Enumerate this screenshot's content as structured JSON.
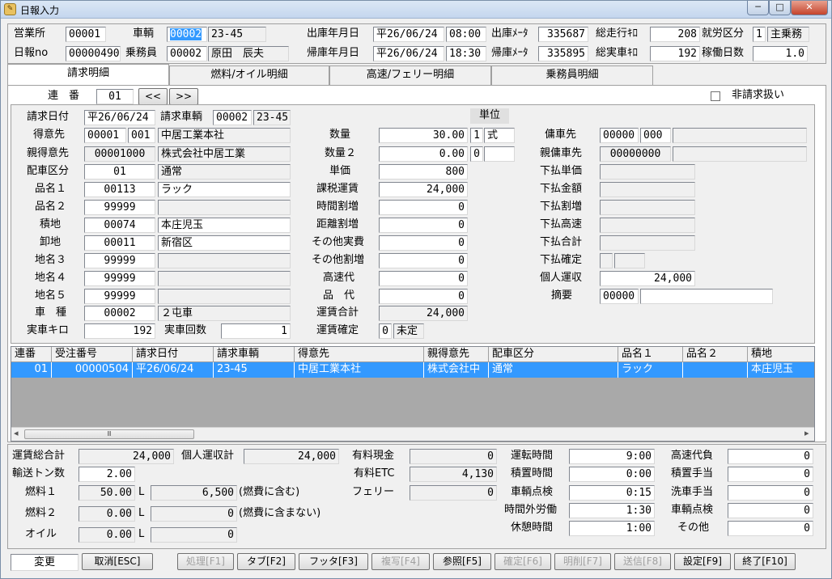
{
  "window": {
    "title": "日報入力",
    "minimize": "─",
    "maximize": "□",
    "close": "✕"
  },
  "header": {
    "office_label": "営業所",
    "office_value": "00001",
    "vehicle_label": "車輌",
    "vehicle_code": "00002",
    "vehicle_no": "23-45",
    "out_date_label": "出庫年月日",
    "out_date": "平26/06/24",
    "out_time": "08:00",
    "out_meter_label": "出庫ﾒｰﾀ",
    "out_meter": "335687",
    "total_km_label": "総走行ｷﾛ",
    "total_km": "208",
    "work_type_label": "就労区分",
    "work_type_code": "1",
    "work_type_name": "主乗務",
    "report_no_label": "日報no",
    "report_no": "00000490",
    "crew_label": "乗務員",
    "crew_code": "00002",
    "crew_name": "原田　辰夫",
    "in_date_label": "帰庫年月日",
    "in_date": "平26/06/24",
    "in_time": "18:30",
    "in_meter_label": "帰庫ﾒｰﾀ",
    "in_meter": "335895",
    "actual_km_label": "総実車ｷﾛ",
    "actual_km": "192",
    "work_days_label": "稼働日数",
    "work_days": "1.0"
  },
  "tabs": [
    "請求明細",
    "燃料/オイル明細",
    "高速/フェリー明細",
    "乗務員明細"
  ],
  "detail": {
    "seq_label": "連　番",
    "seq": "01",
    "prev": "<<",
    "next": ">>",
    "nonbill_label": "非請求扱い",
    "bill_date_label": "請求日付",
    "bill_date": "平26/06/24",
    "bill_vehicle_label": "請求車輌",
    "bill_vehicle_code": "00002",
    "bill_vehicle_no": "23-45",
    "customer_label": "得意先",
    "customer_code": "00001",
    "customer_sub": "001",
    "customer_name": "中居工業本社",
    "parent_label": "親得意先",
    "parent_code": "00001000",
    "parent_name": "株式会社中居工業",
    "dispatch_label": "配車区分",
    "dispatch_code": "01",
    "dispatch_name": "通常",
    "item1_label": "品名１",
    "item1_code": "00113",
    "item1_name": "ラック",
    "item2_label": "品名２",
    "item2_code": "99999",
    "item2_name": "",
    "load_label": "積地",
    "load_code": "00074",
    "load_name": "本庄児玉",
    "unload_label": "卸地",
    "unload_code": "00011",
    "unload_name": "新宿区",
    "place3_label": "地名３",
    "place3_code": "99999",
    "place4_label": "地名４",
    "place4_code": "99999",
    "place5_label": "地名５",
    "place5_code": "99999",
    "car_type_label": "車　種",
    "car_type_code": "00002",
    "car_type_name": "２屯車",
    "real_km_label": "実車キロ",
    "real_km": "192",
    "real_count_label": "実車回数",
    "real_count": "1",
    "unit_label": "単位",
    "qty_label": "数量",
    "qty": "30.00",
    "qty_unit_code": "1",
    "qty_unit": "式",
    "qty2_label": "数量２",
    "qty2": "0.00",
    "qty2_unit_code": "0",
    "price_label": "単価",
    "price": "800",
    "taxable_label": "課税運賃",
    "taxable": "24,000",
    "time_extra_label": "時間割増",
    "time_extra": "0",
    "dist_extra_label": "距離割増",
    "dist_extra": "0",
    "other_cost_label": "その他実費",
    "other_cost": "0",
    "other_extra_label": "その他割増",
    "other_extra": "0",
    "highway_label": "高速代",
    "highway": "0",
    "goods_label": "品　代",
    "goods": "0",
    "fare_total_label": "運賃合計",
    "fare_total": "24,000",
    "fare_confirm_label": "運賃確定",
    "fare_confirm_code": "0",
    "fare_confirm": "未定",
    "charter_label": "傭車先",
    "charter_code": "00000",
    "charter_sub": "000",
    "parent_charter_label": "親傭車先",
    "parent_charter_code": "00000000",
    "sub_price_label": "下払単価",
    "sub_amount_label": "下払金額",
    "sub_extra_label": "下払割増",
    "sub_highway_label": "下払高速",
    "sub_total_label": "下払合計",
    "sub_confirm_label": "下払確定",
    "personal_label": "個人運収",
    "personal": "24,000",
    "summary_label": "摘要",
    "summary_code": "00000"
  },
  "grid": {
    "columns": [
      "連番",
      "受注番号",
      "請求日付",
      "請求車輌",
      "得意先",
      "親得意先",
      "配車区分",
      "品名１",
      "品名２",
      "積地"
    ],
    "row": [
      "01",
      "00000504",
      "平26/06/24",
      "23-45",
      "中居工業本社",
      "株式会社中",
      "通常",
      "ラック",
      "",
      "本庄児玉"
    ],
    "scroll_left": "◂",
    "scroll_grip": "Ⅲ",
    "scroll_right": "▸"
  },
  "footer": {
    "fare_grand_label": "運賃総合計",
    "fare_grand": "24,000",
    "personal_total_label": "個人運収計",
    "personal_total": "24,000",
    "ton_label": "輸送トン数",
    "ton": "2.00",
    "fuel1_label": "燃料１",
    "fuel1_qty": "50.00",
    "fuel1_unit": "L",
    "fuel1_amt": "6,500",
    "fuel1_note": "(燃費に含む)",
    "fuel2_label": "燃料２",
    "fuel2_qty": "0.00",
    "fuel2_unit": "L",
    "fuel2_amt": "0",
    "fuel2_note": "(燃費に含まない)",
    "oil_label": "オイル",
    "oil_qty": "0.00",
    "oil_unit": "L",
    "oil_amt": "0",
    "toll_cash_label": "有料現金",
    "toll_cash": "0",
    "toll_etc_label": "有料ETC",
    "toll_etc": "4,130",
    "ferry_label": "フェリー",
    "ferry": "0",
    "drive_time_label": "運転時間",
    "drive_time": "9:00",
    "load_time_label": "積置時間",
    "load_time": "0:00",
    "inspect_label": "車輌点検",
    "inspect": "0:15",
    "overtime_label": "時間外労働",
    "overtime": "1:30",
    "rest_label": "休憩時間",
    "rest": "1:00",
    "hw_burden_label": "高速代負",
    "hw_burden": "0",
    "load_allow_label": "積置手当",
    "load_allow": "0",
    "wash_label": "洗車手当",
    "wash": "0",
    "car_check_label": "車輌点検",
    "car_check": "0",
    "other_label": "その他",
    "other": "0"
  },
  "buttons": {
    "mode": "変更",
    "cancel": "取消[ESC]",
    "process": "処理[F1]",
    "tab": "タブ[F2]",
    "footer": "フッタ[F3]",
    "copy": "複写[F4]",
    "ref": "参照[F5]",
    "confirm": "確定[F6]",
    "delete": "明削[F7]",
    "send": "送信[F8]",
    "settings": "設定[F9]",
    "exit": "終了[F10]"
  }
}
